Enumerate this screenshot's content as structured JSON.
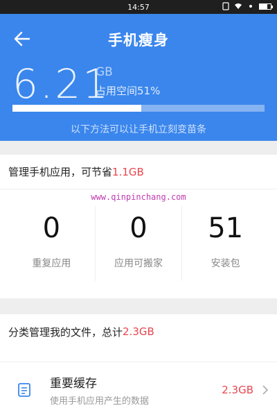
{
  "status_bar": {
    "time": "14:57"
  },
  "header": {
    "title": "手机瘦身",
    "used_value": "6.21",
    "used_unit": "GB",
    "occupy_text": "占用空间51%",
    "progress": 0.51,
    "tip": "以下方法可以让手机立刻变苗条"
  },
  "apps_section": {
    "title_prefix": "管理手机应用，可节省",
    "title_highlight": "1.1GB",
    "watermark": "www.qinpinchang.com",
    "stats": [
      {
        "value": "0",
        "label": "重复应用"
      },
      {
        "value": "0",
        "label": "应用可搬家"
      },
      {
        "value": "51",
        "label": "安装包"
      }
    ]
  },
  "files_section": {
    "title_prefix": "分类管理我的文件，总计",
    "title_highlight": "2.3GB",
    "items": [
      {
        "title": "重要缓存",
        "subtitle": "使用手机应用产生的数据",
        "size": "2.3GB"
      }
    ]
  },
  "colors": {
    "header_blue": "#3a86ec",
    "highlight_red": "#e8454f"
  }
}
